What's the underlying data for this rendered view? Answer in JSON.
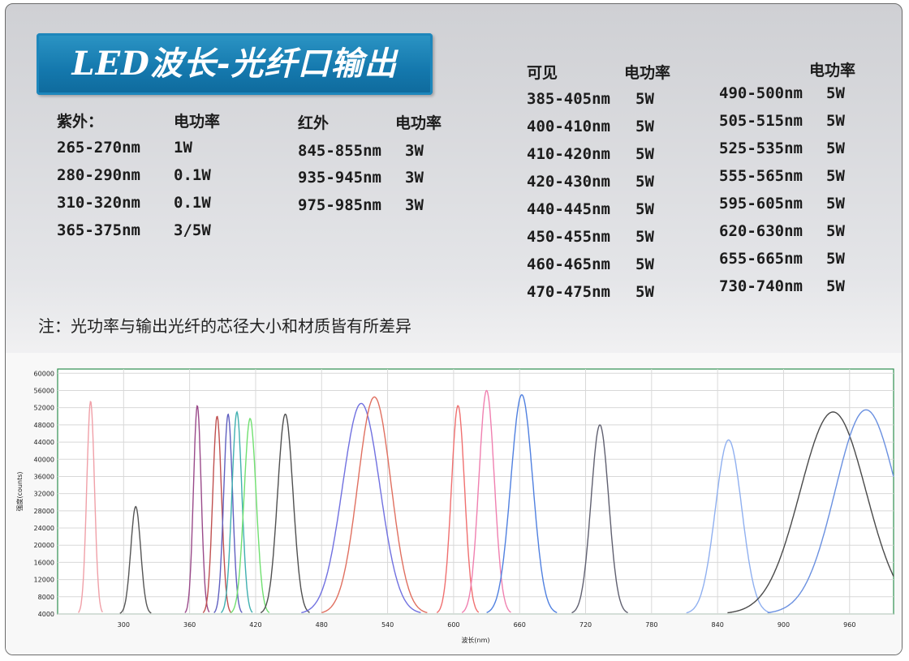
{
  "title": "LED波长-光纤口输出",
  "uv": {
    "heading": "紫外：",
    "power_heading": "电功率",
    "rows": [
      {
        "wl": "265-270nm",
        "p": "1W"
      },
      {
        "wl": "280-290nm",
        "p": "0.1W"
      },
      {
        "wl": "310-320nm",
        "p": "0.1W"
      },
      {
        "wl": "365-375nm",
        "p": "3/5W"
      }
    ]
  },
  "ir": {
    "heading": "红外",
    "power_heading": "电功率",
    "rows": [
      {
        "wl": "845-855nm",
        "p": "3W"
      },
      {
        "wl": "935-945nm",
        "p": "3W"
      },
      {
        "wl": "975-985nm",
        "p": "3W"
      }
    ]
  },
  "visible": {
    "heading": "可见",
    "power_heading": "电功率",
    "rows": [
      {
        "wl": "385-405nm",
        "p": "5W"
      },
      {
        "wl": "400-410nm",
        "p": "5W"
      },
      {
        "wl": "410-420nm",
        "p": "5W"
      },
      {
        "wl": "420-430nm",
        "p": "5W"
      },
      {
        "wl": "440-445nm",
        "p": "5W"
      },
      {
        "wl": "450-455nm",
        "p": "5W"
      },
      {
        "wl": "460-465nm",
        "p": "5W"
      },
      {
        "wl": "470-475nm",
        "p": "5W"
      }
    ]
  },
  "visible2": {
    "power_heading": "电功率",
    "rows": [
      {
        "wl": "490-500nm",
        "p": "5W"
      },
      {
        "wl": "505-515nm",
        "p": "5W"
      },
      {
        "wl": "525-535nm",
        "p": "5W"
      },
      {
        "wl": "555-565nm",
        "p": "5W"
      },
      {
        "wl": "595-605nm",
        "p": "5W"
      },
      {
        "wl": "620-630nm",
        "p": "5W"
      },
      {
        "wl": "655-665nm",
        "p": "5W"
      },
      {
        "wl": "730-740nm",
        "p": "5W"
      }
    ]
  },
  "note": "注：光功率与输出光纤的芯径大小和材质皆有所差异",
  "chart_data": {
    "type": "line",
    "title": "",
    "xlabel": "波长(nm)",
    "ylabel": "强度(counts)",
    "xlim": [
      240,
      1000
    ],
    "ylim": [
      4000,
      61000
    ],
    "xticks": [
      300,
      360,
      420,
      480,
      540,
      600,
      660,
      720,
      780,
      840,
      900,
      960
    ],
    "yticks": [
      4000,
      8000,
      12000,
      16000,
      20000,
      24000,
      28000,
      32000,
      36000,
      40000,
      44000,
      48000,
      52000,
      56000,
      60000
    ],
    "grid": true,
    "series": [
      {
        "peak": 270,
        "intensity": 53500,
        "width": 3.5,
        "color": "#f0a0a8"
      },
      {
        "peak": 311,
        "intensity": 29000,
        "width": 4.5,
        "color": "#555555"
      },
      {
        "peak": 367,
        "intensity": 52500,
        "width": 3.5,
        "color": "#9a4a8a"
      },
      {
        "peak": 385,
        "intensity": 50000,
        "width": 4,
        "color": "#c05050"
      },
      {
        "peak": 395,
        "intensity": 50500,
        "width": 4,
        "color": "#6060c0"
      },
      {
        "peak": 403,
        "intensity": 51000,
        "width": 4.5,
        "color": "#40b0b0"
      },
      {
        "peak": 415,
        "intensity": 49500,
        "width": 5.5,
        "color": "#70e070"
      },
      {
        "peak": 447,
        "intensity": 50500,
        "width": 7,
        "color": "#505050"
      },
      {
        "peak": 516,
        "intensity": 53000,
        "width": 17,
        "color": "#7070e0"
      },
      {
        "peak": 528,
        "intensity": 54500,
        "width": 15,
        "color": "#e07060"
      },
      {
        "peak": 604,
        "intensity": 52500,
        "width": 6,
        "color": "#f07070"
      },
      {
        "peak": 630,
        "intensity": 56000,
        "width": 7,
        "color": "#f080b0"
      },
      {
        "peak": 662,
        "intensity": 55000,
        "width": 10,
        "color": "#5080e0"
      },
      {
        "peak": 733,
        "intensity": 48000,
        "width": 8,
        "color": "#606070"
      },
      {
        "peak": 850,
        "intensity": 44500,
        "width": 12,
        "color": "#90b0f0"
      },
      {
        "peak": 945,
        "intensity": 51000,
        "width": 30,
        "color": "#4a4a4a"
      },
      {
        "peak": 975,
        "intensity": 51500,
        "width": 28,
        "color": "#6a90e0"
      }
    ]
  }
}
